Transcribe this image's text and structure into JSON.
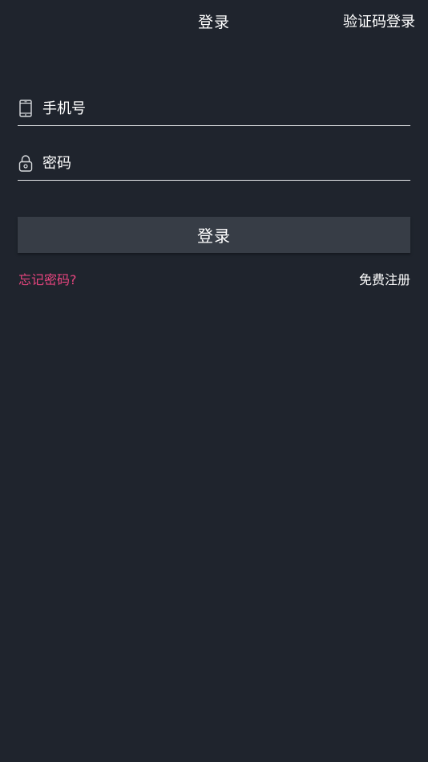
{
  "header": {
    "title": "登录",
    "action_label": "验证码登录"
  },
  "form": {
    "phone": {
      "placeholder": "手机号",
      "value": "",
      "icon": "phone-icon"
    },
    "password": {
      "placeholder": "密码",
      "value": "",
      "icon": "lock-icon"
    },
    "submit_label": "登录"
  },
  "links": {
    "forgot": "忘记密码?",
    "register": "免费注册"
  },
  "colors": {
    "background": "#1f242d",
    "button": "#373d46",
    "accent_link": "#e8457f",
    "text": "#ffffff"
  }
}
